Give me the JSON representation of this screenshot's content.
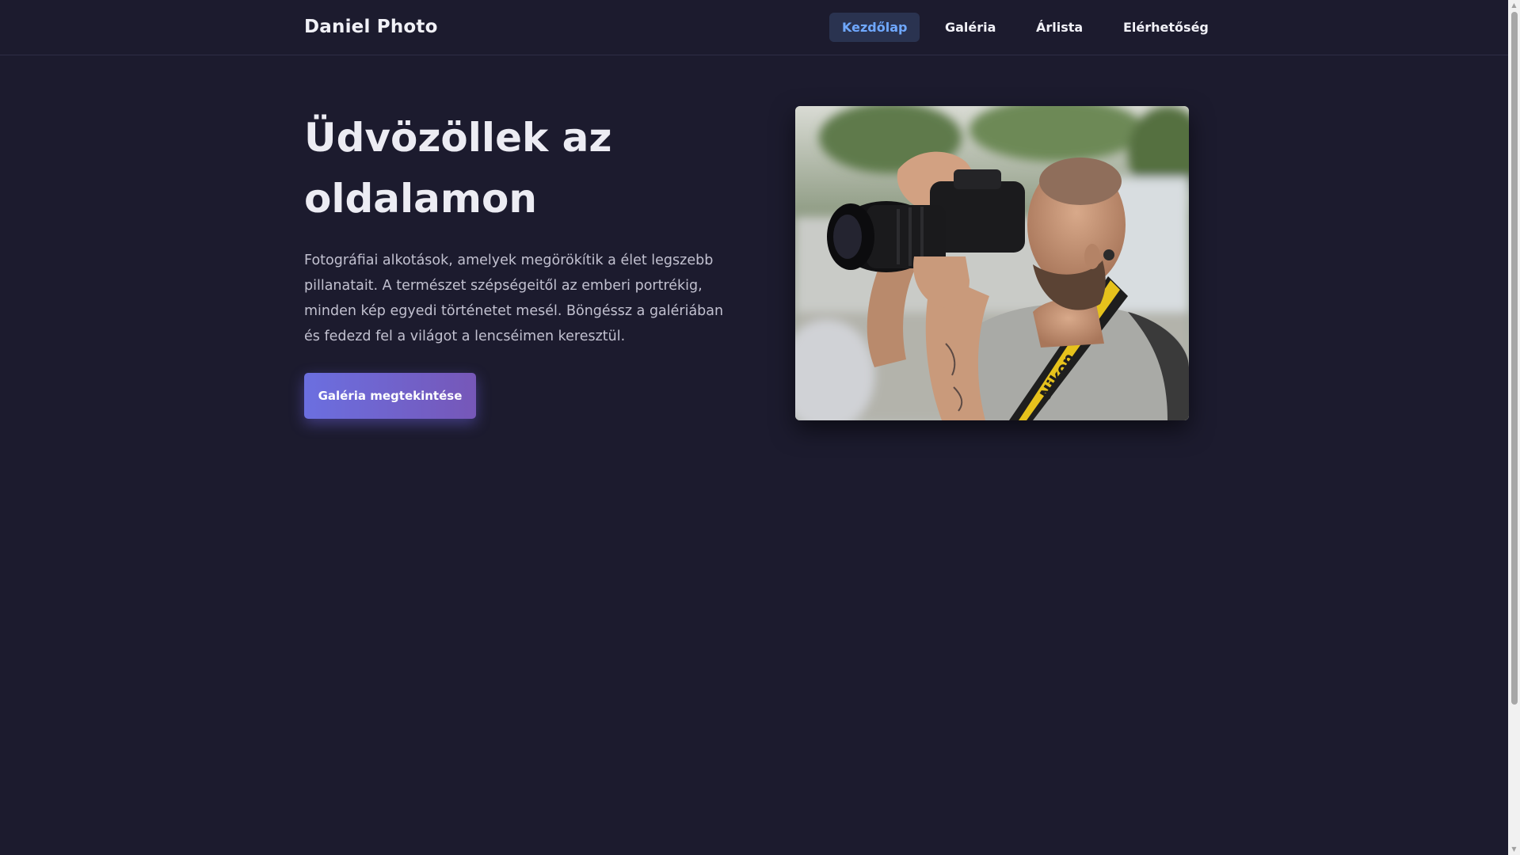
{
  "header": {
    "brand": "Daniel Photo",
    "nav": [
      {
        "label": "Kezdőlap",
        "active": true
      },
      {
        "label": "Galéria",
        "active": false
      },
      {
        "label": "Árlista",
        "active": false
      },
      {
        "label": "Elérhetőség",
        "active": false
      }
    ]
  },
  "hero": {
    "title": "Üdvözöllek az oldalamon",
    "text": "Fotográfiai alkotások, amelyek megörökítik a élet legszebb pillanatait. A természet szépségeitől az emberi portrékig, minden kép egyedi történetet mesél. Böngéssz a galériában és fedezd fel a világot a lencséimen keresztül.",
    "cta_label": "Galéria megtekintése"
  },
  "photo": {
    "strap_text": "Nikon"
  },
  "colors": {
    "background": "#1c1b2e",
    "nav_active_bg": "#2a3350",
    "nav_active_text": "#6fa8ff",
    "cta_gradient_start": "#6b6fe0",
    "cta_gradient_end": "#7657b8"
  }
}
